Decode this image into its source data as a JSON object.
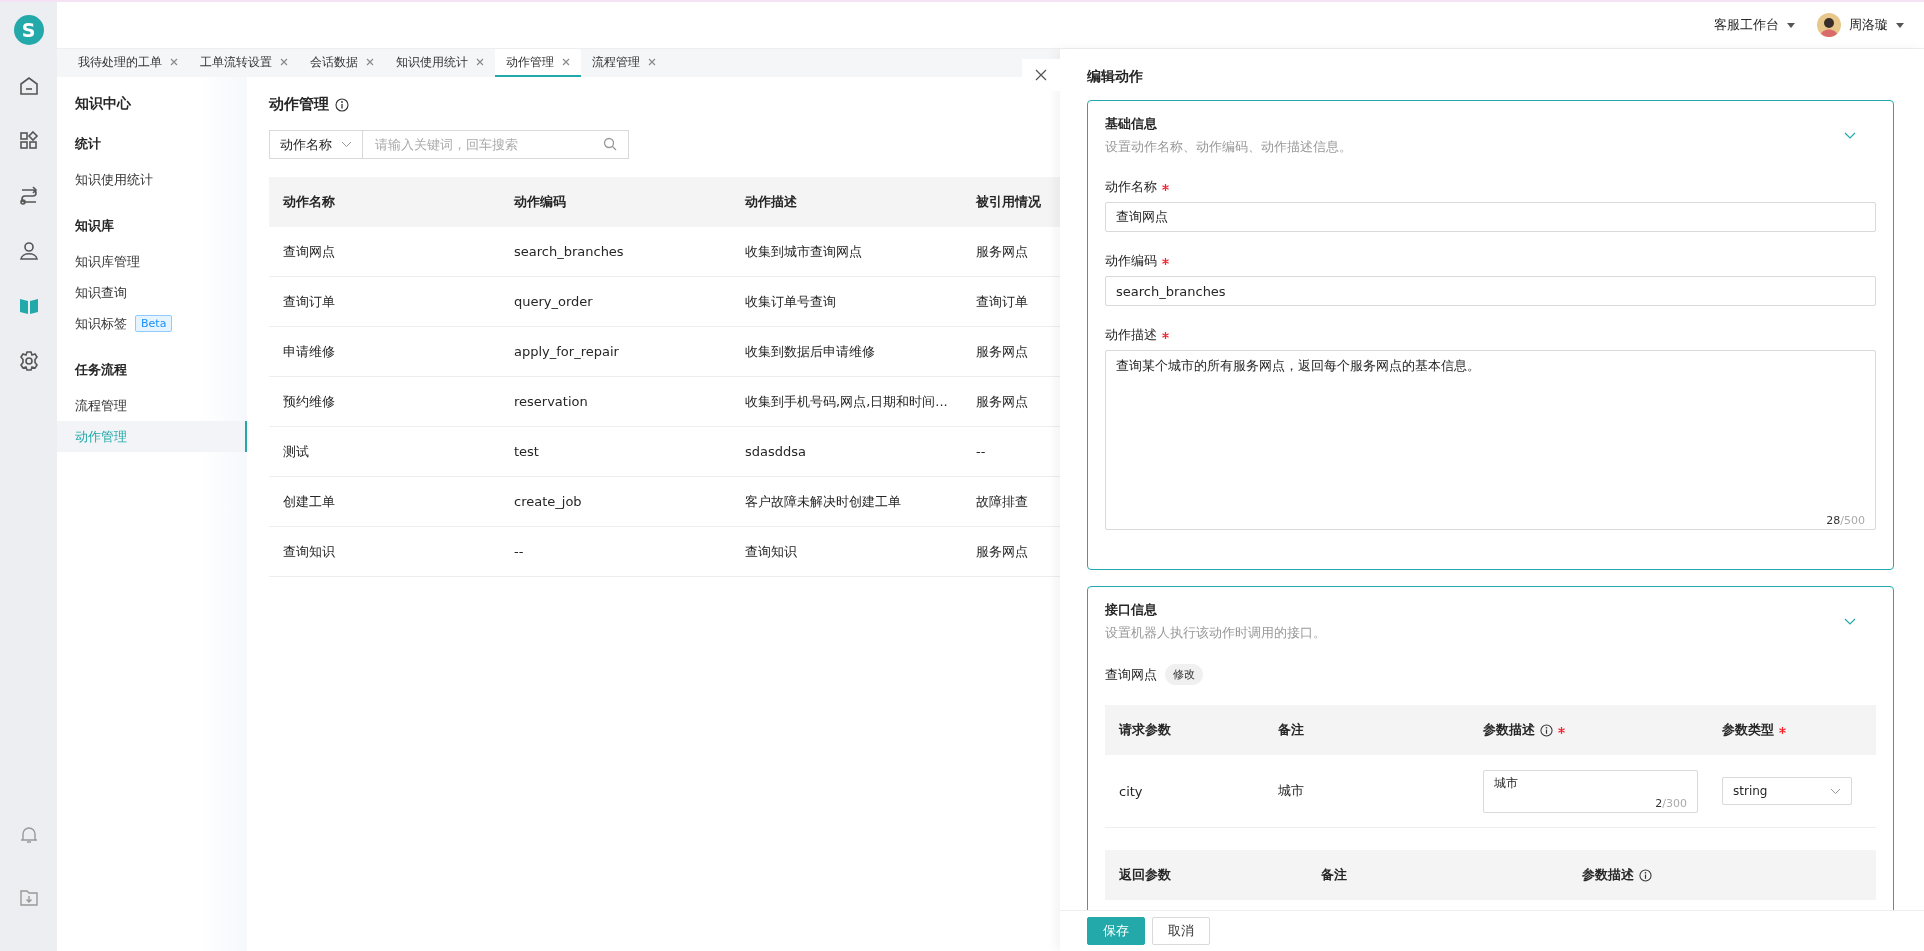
{
  "logo": "S",
  "rail": [
    {
      "kind": "home",
      "selected": false
    },
    {
      "kind": "apps",
      "selected": false
    },
    {
      "kind": "flow",
      "selected": false
    },
    {
      "kind": "person",
      "selected": false
    },
    {
      "kind": "book",
      "selected": true
    },
    {
      "kind": "settings",
      "selected": false
    }
  ],
  "rail_bottom": [
    {
      "kind": "bell"
    },
    {
      "kind": "download"
    }
  ],
  "header": {
    "workspace": "客服工作台",
    "user": "周洛璇"
  },
  "tabs": [
    {
      "label": "我待处理的工单",
      "selected": false
    },
    {
      "label": "工单流转设置",
      "selected": false
    },
    {
      "label": "会话数据",
      "selected": false
    },
    {
      "label": "知识使用统计",
      "selected": false
    },
    {
      "label": "动作管理",
      "selected": true
    },
    {
      "label": "流程管理",
      "selected": false
    }
  ],
  "sidebar": {
    "title": "知识中心",
    "groups": [
      {
        "title": "统计",
        "items": [
          {
            "label": "知识使用统计",
            "selected": false
          }
        ]
      },
      {
        "title": "知识库",
        "items": [
          {
            "label": "知识库管理",
            "selected": false
          },
          {
            "label": "知识查询",
            "selected": false
          },
          {
            "label": "知识标签",
            "selected": false,
            "badge": "Beta"
          }
        ]
      },
      {
        "title": "任务流程",
        "items": [
          {
            "label": "流程管理",
            "selected": false
          },
          {
            "label": "动作管理",
            "selected": true
          }
        ]
      }
    ]
  },
  "page": {
    "title": "动作管理",
    "search": {
      "field": "动作名称",
      "placeholder": "请输入关键词，回车搜索"
    },
    "table": {
      "columns": [
        "动作名称",
        "动作编码",
        "动作描述",
        "被引用情况"
      ],
      "rows": [
        [
          "查询网点",
          "search_branches",
          "收集到城市查询网点",
          "服务网点"
        ],
        [
          "查询订单",
          "query_order",
          "收集订单号查询",
          "查询订单"
        ],
        [
          "申请维修",
          "apply_for_repair",
          "收集到数据后申请维修",
          "服务网点"
        ],
        [
          "预约维修",
          "reservation",
          "收集到手机号码,网点,日期和时间...",
          "服务网点"
        ],
        [
          "测试",
          "test",
          "sdasddsa",
          "--"
        ],
        [
          "创建工单",
          "create_job",
          "客户故障未解决时创建工单",
          "故障排查"
        ],
        [
          "查询知识",
          "--",
          "查询知识",
          "服务网点"
        ]
      ]
    }
  },
  "drawer": {
    "title": "编辑动作",
    "basic": {
      "title": "基础信息",
      "subtitle": "设置动作名称、动作编码、动作描述信息。",
      "fields": [
        {
          "kind": "input",
          "label": "动作名称",
          "required": true,
          "value": "查询网点"
        },
        {
          "kind": "input",
          "label": "动作编码",
          "required": true,
          "value": "search_branches"
        },
        {
          "kind": "textarea",
          "label": "动作描述",
          "required": true,
          "value": "查询某个城市的所有服务网点，返回每个服务网点的基本信息。",
          "count": "28",
          "limit": "/500"
        }
      ]
    },
    "api": {
      "title": "接口信息",
      "subtitle": "设置机器人执行该动作时调用的接口。",
      "endpoint": "查询网点",
      "edit": "修改",
      "request": {
        "columns": [
          {
            "label": "请求参数",
            "info": false,
            "required": false
          },
          {
            "label": "备注",
            "info": false,
            "required": false
          },
          {
            "label": "参数描述",
            "info": true,
            "required": true
          },
          {
            "label": "参数类型",
            "info": false,
            "required": true
          }
        ],
        "rows": [
          {
            "name": "city",
            "note": "城市",
            "description": "城市",
            "count": "2",
            "limit": "/300",
            "type": "string"
          }
        ]
      },
      "response": {
        "columns": [
          {
            "label": "返回参数",
            "info": false
          },
          {
            "label": "备注",
            "info": false
          },
          {
            "label": "参数描述",
            "info": true
          }
        ]
      }
    },
    "buttons": [
      {
        "kind": "primary",
        "label": "保存"
      },
      {
        "kind": "default",
        "label": "取消"
      }
    ]
  }
}
